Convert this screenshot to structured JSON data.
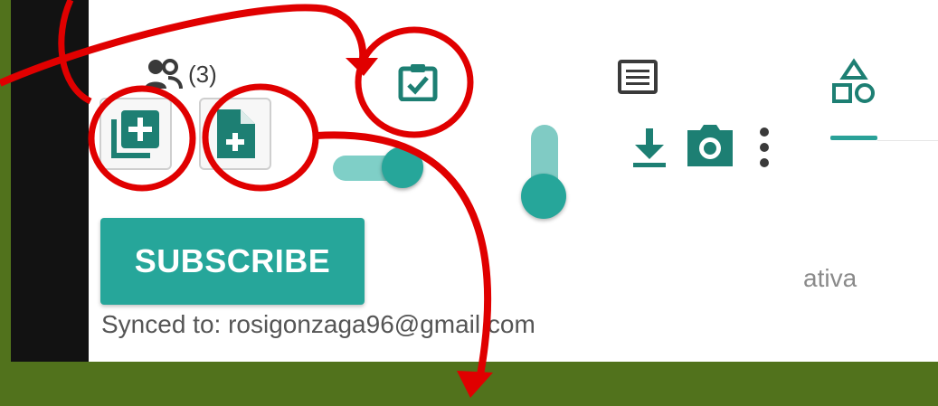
{
  "people": {
    "count_label": "(3)",
    "icon": "people-icon"
  },
  "buttons": {
    "add_collection_icon": "library-add-icon",
    "new_file_icon": "note-add-icon",
    "subscribe_label": "SUBSCRIBE"
  },
  "toolbar": {
    "clipboard_icon": "clipboard-check-icon",
    "list_icon": "list-icon",
    "shapes_icon": "shapes-icon",
    "download_icon": "download-icon",
    "camera_icon": "camera-icon",
    "more_icon": "more-vert-icon"
  },
  "controls": {
    "toggle_on": true,
    "slider_value_fraction": 0.3
  },
  "partial_text": "ativa",
  "synced": "Synced to: rosigonzaga96@gmail.com",
  "colors": {
    "accent": "#26a69a",
    "accent_light": "#80cbc4",
    "annotation": "#e00000",
    "outer_bg": "#51721c",
    "left_strip": "#121212"
  }
}
